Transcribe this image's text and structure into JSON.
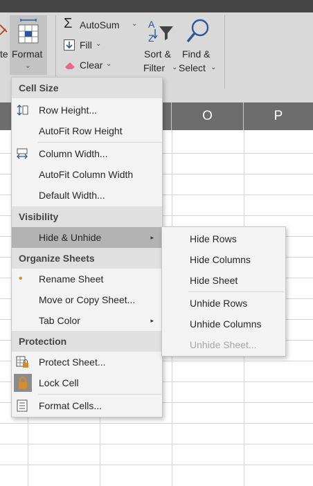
{
  "ribbon": {
    "partial_label": "te",
    "format": {
      "label": "Format",
      "chevron": "⌄"
    },
    "autosum": {
      "label": "AutoSum",
      "chevron": "⌄"
    },
    "fill": {
      "label": "Fill",
      "chevron": "⌄"
    },
    "clear": {
      "label": "Clear",
      "chevron": "⌄"
    },
    "sort_filter": {
      "line1": "Sort &",
      "line2": "Filter",
      "chevron": "⌄"
    },
    "find_select": {
      "line1": "Find &",
      "line2": "Select",
      "chevron": "⌄"
    }
  },
  "grid": {
    "columns": [
      "O",
      "P"
    ]
  },
  "menu": {
    "sections": {
      "cell_size": "Cell Size",
      "visibility": "Visibility",
      "organize": "Organize Sheets",
      "protection": "Protection"
    },
    "items": {
      "row_height": "Row Height...",
      "autofit_row": "AutoFit Row Height",
      "column_width": "Column Width...",
      "autofit_column": "AutoFit Column Width",
      "default_width": "Default Width...",
      "hide_unhide": "Hide & Unhide",
      "rename_sheet": "Rename Sheet",
      "move_copy": "Move or Copy Sheet...",
      "tab_color": "Tab Color",
      "protect_sheet": "Protect Sheet...",
      "lock_cell": "Lock Cell",
      "format_cells": "Format Cells..."
    }
  },
  "submenu": {
    "hide_rows": "Hide Rows",
    "hide_columns": "Hide Columns",
    "hide_sheet": "Hide Sheet",
    "unhide_rows": "Unhide Rows",
    "unhide_columns": "Unhide Columns",
    "unhide_sheet": "Unhide Sheet..."
  },
  "colors": {
    "accent": "#d98b2b",
    "selected": "#b3b3b3",
    "header": "#e0e0e0",
    "column_header": "#6d6d6d"
  },
  "icons": {
    "submenu_arrow": "▸",
    "bullet": "•"
  }
}
